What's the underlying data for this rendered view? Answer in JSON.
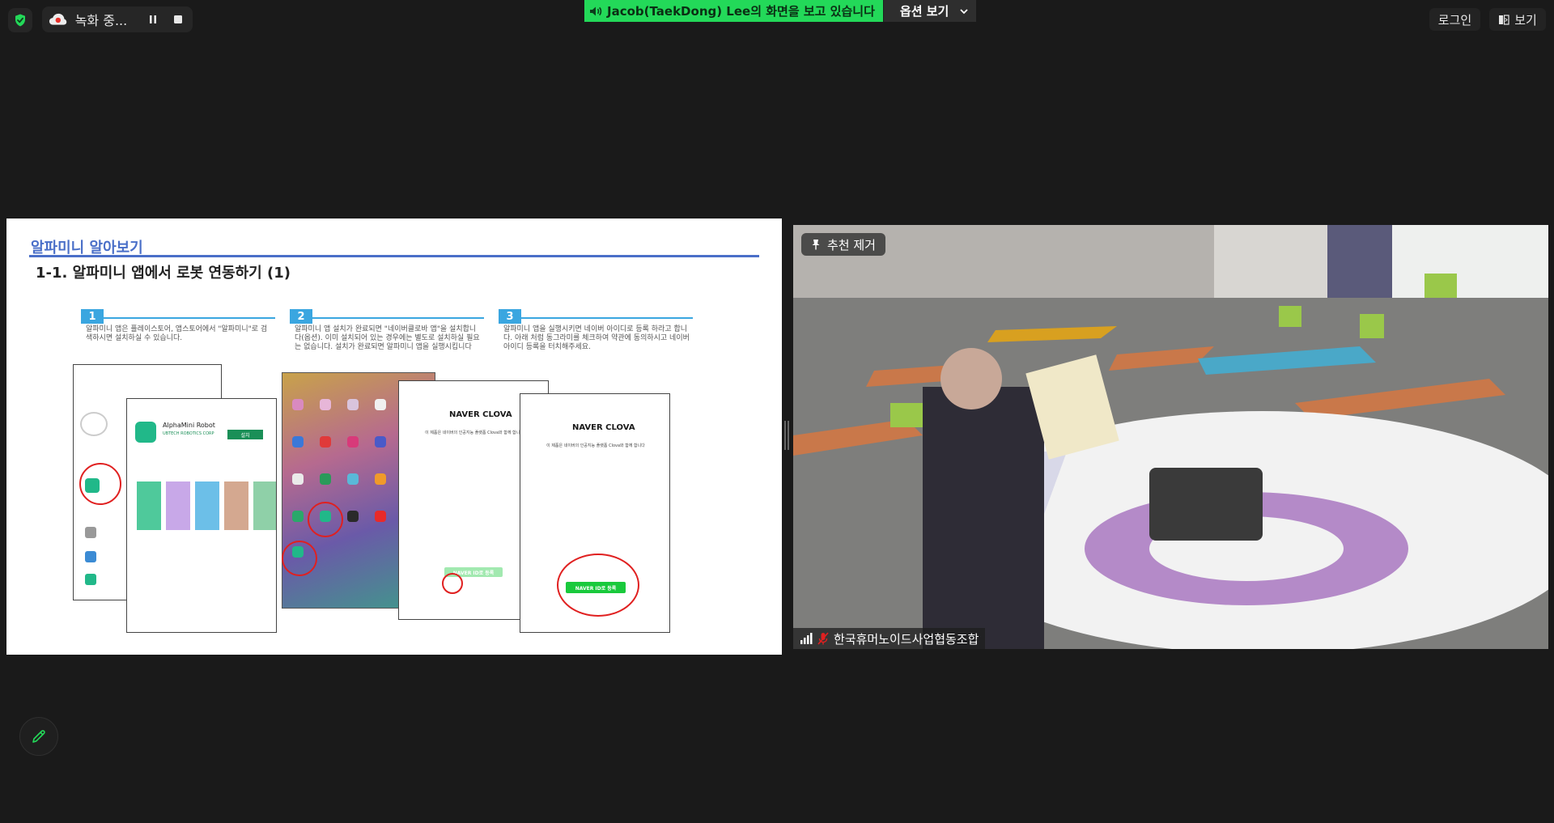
{
  "toolbar": {
    "recording_label": "녹화 중...",
    "share_banner_text": "Jacob(TaekDong)  Lee의 화면을 보고 있습니다",
    "view_options_label": "옵션 보기",
    "login_label": "로그인",
    "view_label": "보기"
  },
  "slide": {
    "section_title": "알파미니 알아보기",
    "subtitle": "1-1.  알파미니 앱에서 로봇 연동하기 (1)",
    "steps": [
      {
        "num": "1",
        "text": "알파미니 앱은 플레이스토어, 앱스토어에서 \"알파미니\"로 검색하시면 설치하실 수 있습니다."
      },
      {
        "num": "2",
        "text": "알파미니 앱 설치가 완료되면 \"네이버클로바 앱\"을 설치합니다(옵션). 이미 설치되어 있는 경우에는 별도로 설치하실 필요는 없습니다. 설치가 완료되면 알파미니 앱을 실행시킵니다"
      },
      {
        "num": "3",
        "text": "알파미니 앱을 실행시키면 네이버 아이디로 등록 하라고 합니다. 아래 처럼 동그라미를 체크하여 약관에 동의하시고 네이버 아이디 등록을 터치해주세요."
      }
    ],
    "app_name": "AlphaMini Robot",
    "app_publisher": "UBTECH ROBOTICS CORP",
    "install_label": "설치",
    "clova_logo": "NAVER CLOVA",
    "clova_button": "NAVER ID로 등록",
    "clova_notice": "이 제품은 네이버의 인공지능 플랫폼 Clova와 함께 합니다"
  },
  "video": {
    "pin_label": "추천 제거",
    "participant_name": "한국휴머노이드사업협동조합"
  },
  "colors": {
    "banner_green": "#23d959",
    "slide_accent": "#4a6fc8",
    "step_blue": "#3aa6e0",
    "annotation_red": "#e02020"
  }
}
